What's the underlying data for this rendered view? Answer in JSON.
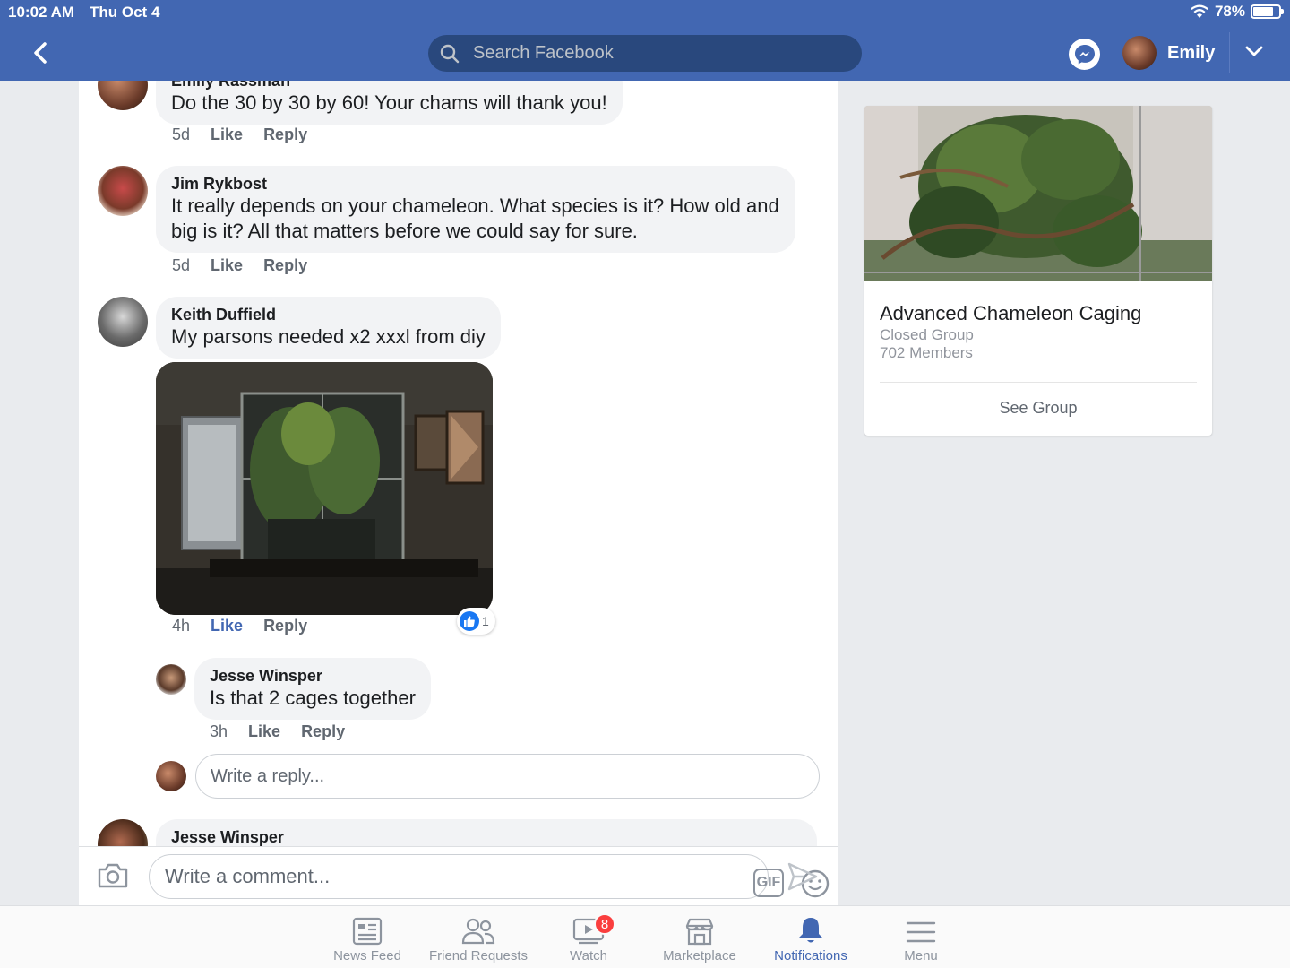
{
  "status_bar": {
    "time": "10:02 AM",
    "date": "Thu Oct 4",
    "battery": "78%",
    "battery_level": 0.78
  },
  "header": {
    "search_placeholder": "Search Facebook",
    "profile_name": "Emily"
  },
  "comments": [
    {
      "author": "Emily Rassman",
      "text": "Do the 30 by 30 by 60! Your chams will thank you!",
      "time": "5d",
      "like": "Like",
      "reply": "Reply"
    },
    {
      "author": "Jim Rykbost",
      "text_line1": "It really depends on your chameleon. What species is it? How old and",
      "text_line2": "big is it? All that matters before we could say for sure.",
      "time": "5d",
      "like": "Like",
      "reply": "Reply"
    },
    {
      "author": "Keith Duffield",
      "text": "My parsons needed x2 xxxl from diy",
      "time": "4h",
      "like": "Like",
      "reply": "Reply",
      "reaction_count": "1"
    },
    {
      "author": "Jesse Winsper",
      "text": "Is that 2 cages together",
      "time": "3h",
      "like": "Like",
      "reply": "Reply"
    },
    {
      "author": "Jesse Winsper"
    }
  ],
  "reply_input_placeholder": "Write a reply...",
  "comment_input_placeholder": "Write a comment...",
  "gif_label": "GIF",
  "group_card": {
    "title": "Advanced Chameleon Caging",
    "privacy": "Closed Group",
    "members": "702 Members",
    "button": "See Group"
  },
  "tabs": [
    {
      "label": "News Feed",
      "icon": "news-feed-icon"
    },
    {
      "label": "Friend Requests",
      "icon": "friend-requests-icon"
    },
    {
      "label": "Watch",
      "icon": "watch-icon",
      "badge": "8"
    },
    {
      "label": "Marketplace",
      "icon": "marketplace-icon"
    },
    {
      "label": "Notifications",
      "icon": "bell-icon",
      "active": true
    },
    {
      "label": "Menu",
      "icon": "menu-icon"
    }
  ],
  "colors": {
    "brand": "#4267b2",
    "bubble": "#f2f3f5",
    "badge": "#fa3e3e",
    "like_blue": "#1877f2"
  }
}
